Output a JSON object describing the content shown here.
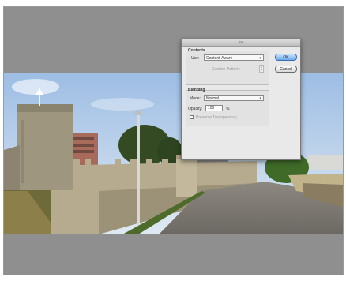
{
  "dialog": {
    "title": "Fill",
    "contents_group_title": "Contents",
    "use_label": "Use:",
    "use_value": "Content-Aware",
    "custom_pattern_label": "Custom Pattern:",
    "blending_group_title": "Blending",
    "mode_label": "Mode:",
    "mode_value": "Normal",
    "opacity_label": "Opacity:",
    "opacity_value": "100",
    "opacity_unit": "%",
    "preserve_transparency_label": "Preserve Transparency",
    "ok_label": "OK",
    "cancel_label": "Cancel"
  },
  "colors": {
    "canvas_gray": "#8f8f8f",
    "dialog_bg": "#e9e9e9",
    "ok_blue": "#6fa8ea",
    "sky": "#a9c6e6",
    "stone": "#b7ab8f",
    "grass": "#4e6b2c",
    "road": "#7a7570"
  },
  "icons": {
    "select_caret": "chevron-down-icon"
  }
}
